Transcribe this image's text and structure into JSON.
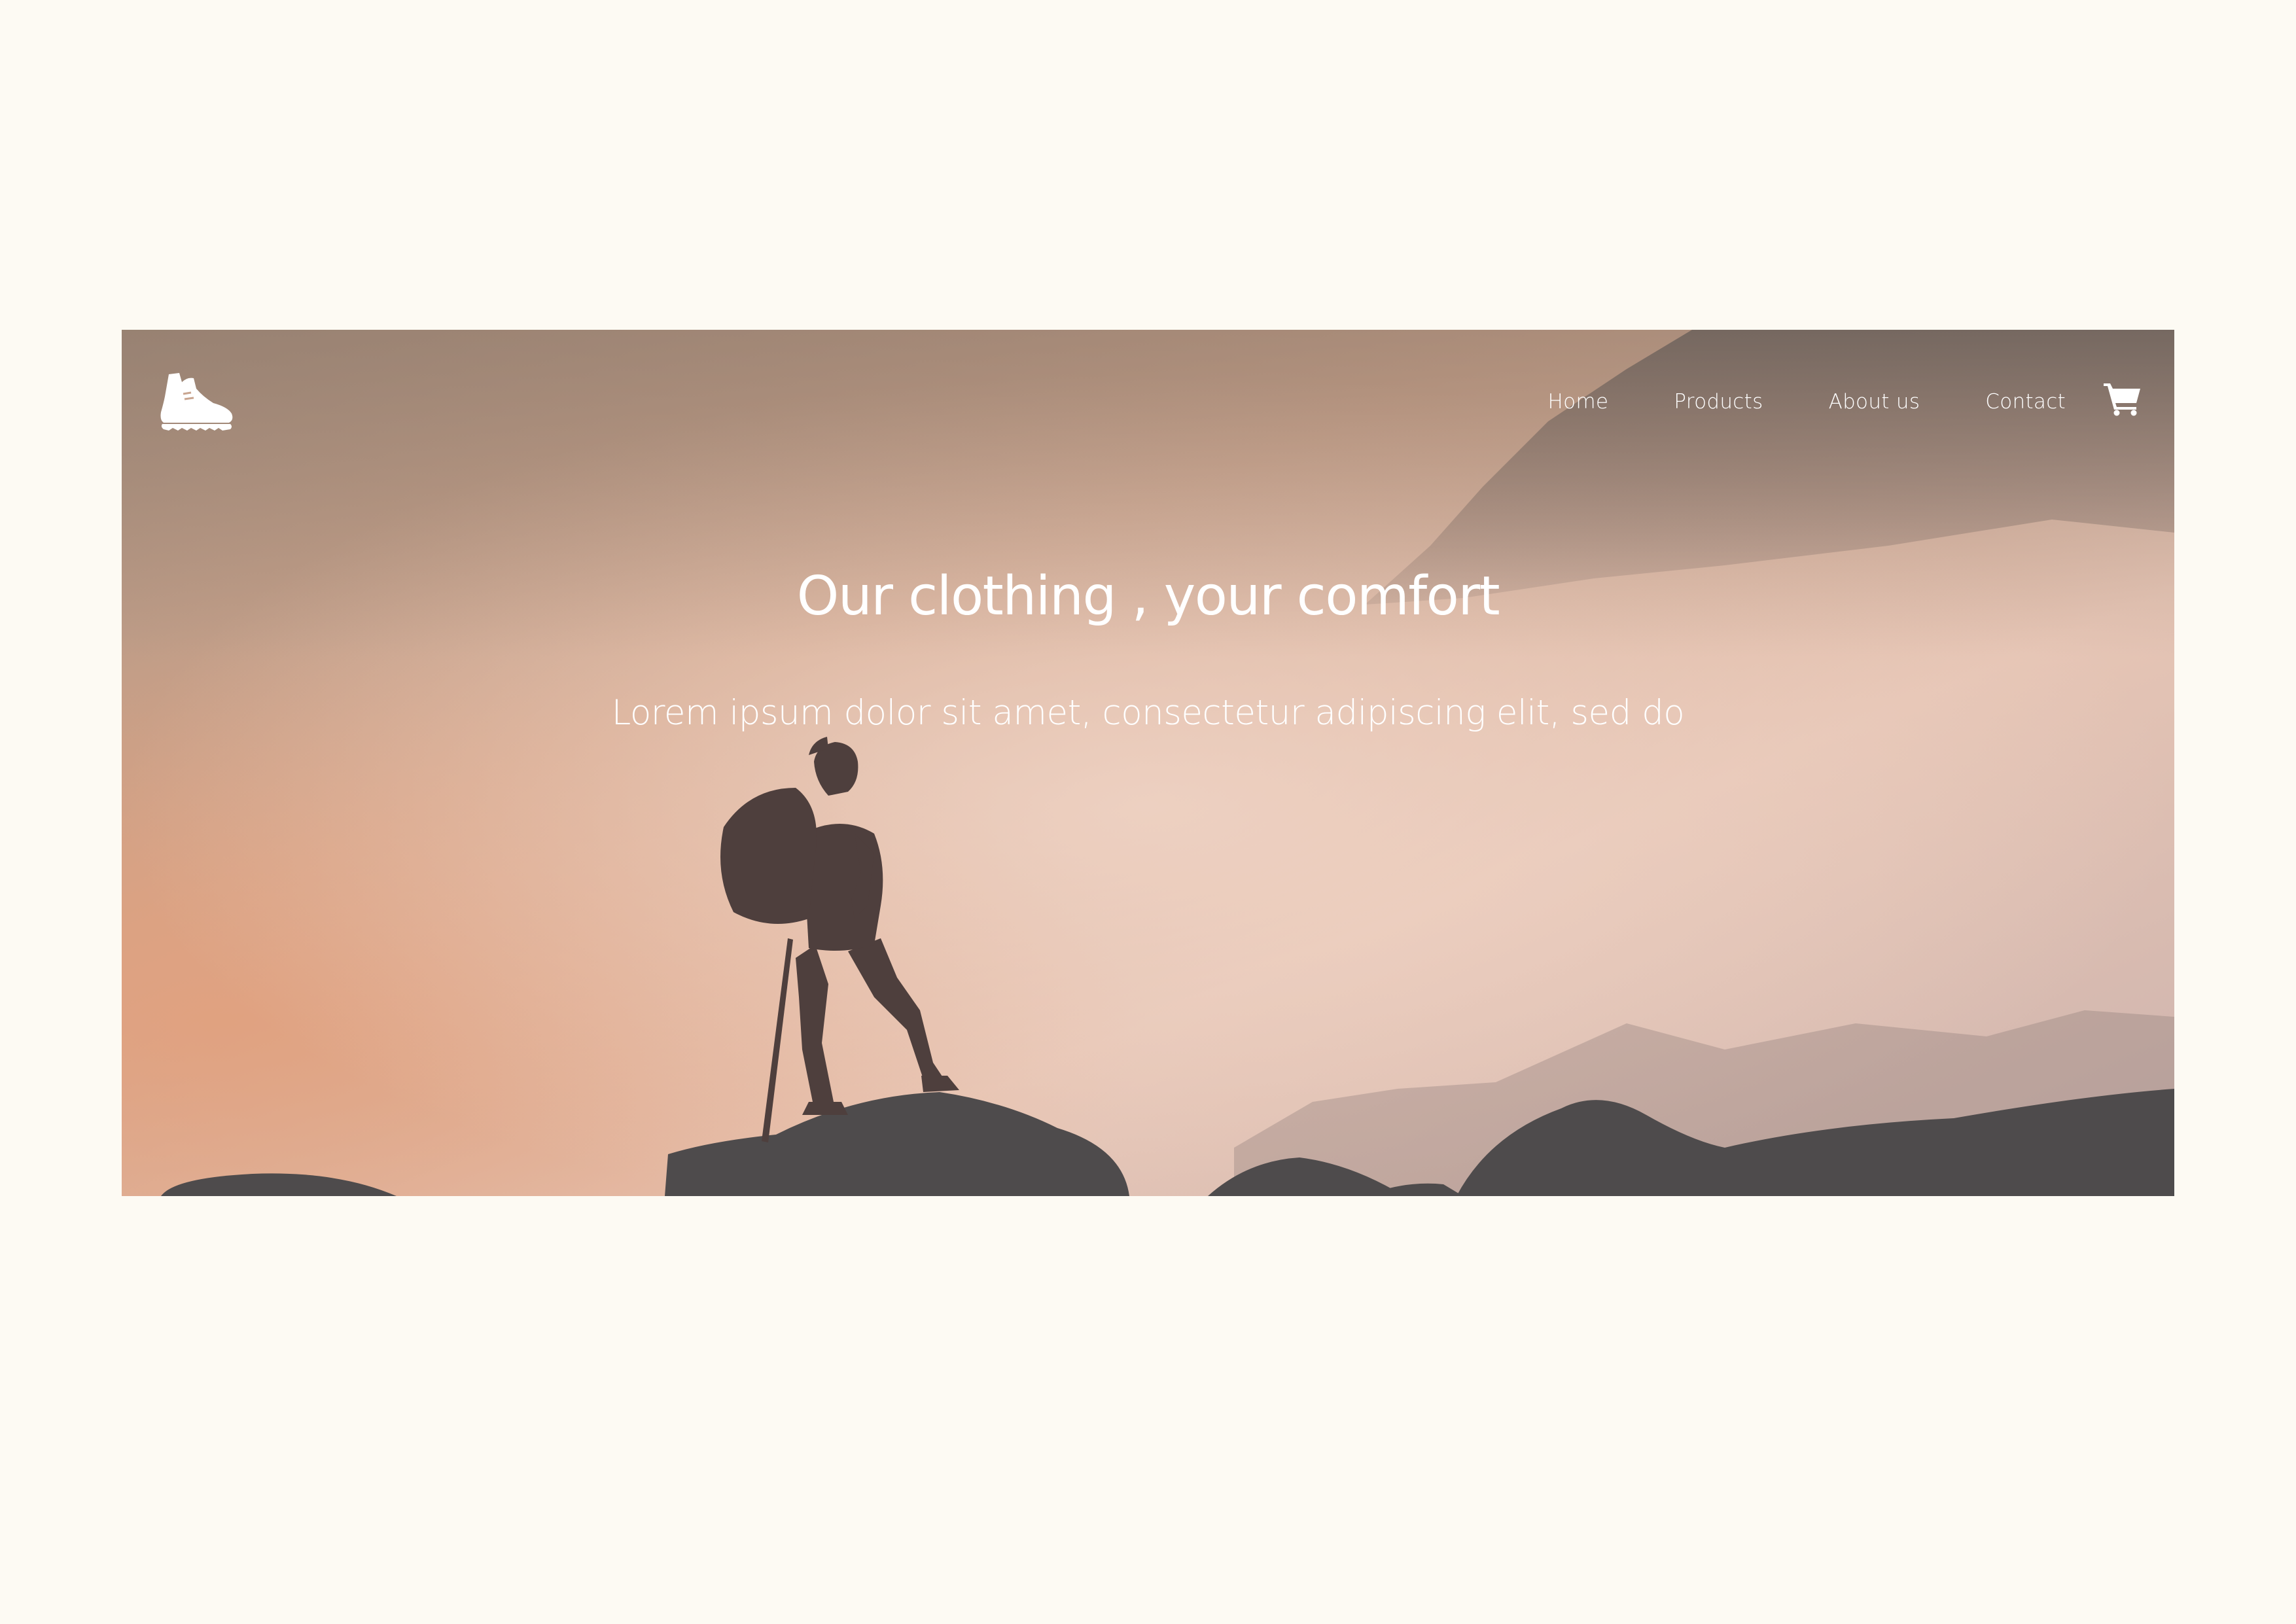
{
  "header": {
    "logo_icon": "hiking-boot-icon",
    "nav": [
      {
        "label": "Home"
      },
      {
        "label": "Products"
      },
      {
        "label": "About us"
      },
      {
        "label": "Contact"
      }
    ],
    "cart_icon": "shopping-cart-icon"
  },
  "hero": {
    "title": "Our clothing , your comfort",
    "subtitle": "Lorem ipsum dolor sit amet, consectetur adipiscing elit, sed do",
    "image": "hiker-silhouette-on-rocks-in-foggy-mountains"
  },
  "colors": {
    "page_background": "#fdfaf3",
    "hero_tint": "#d9ae96",
    "text": "#ffffff",
    "rock": "#4e4b4c"
  }
}
